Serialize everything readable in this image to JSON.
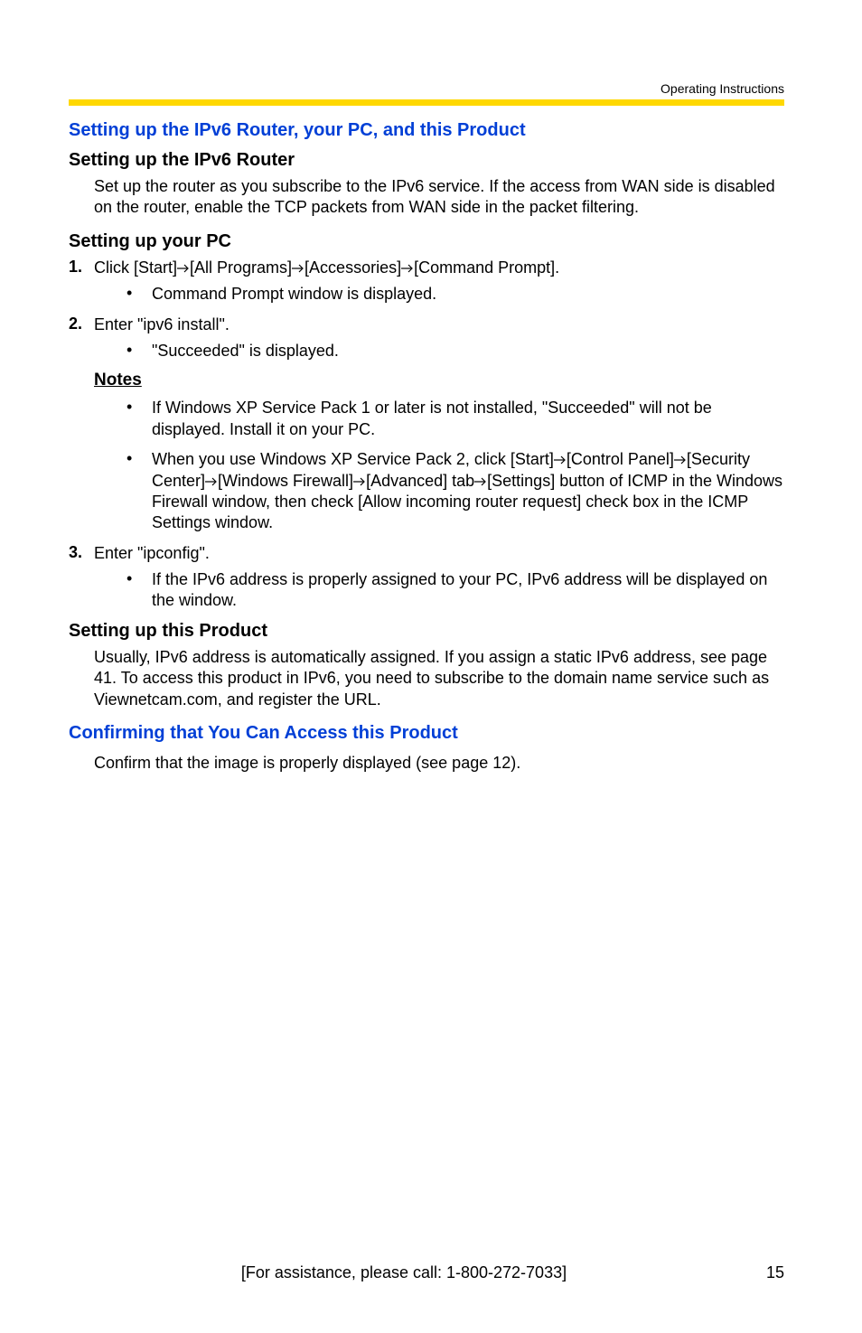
{
  "header": {
    "label": "Operating Instructions"
  },
  "s1": {
    "title": "Setting up the IPv6 Router, your PC, and this Product",
    "sub1": {
      "title": "Setting up the IPv6 Router",
      "body": "Set up the router as you subscribe to the IPv6 service. If the access from WAN side is disabled on the router, enable the TCP packets from WAN side in the packet filtering."
    },
    "sub2": {
      "title": "Setting up your PC",
      "step1": {
        "pre": "Click [Start]",
        "mid1": "[All Programs]",
        "mid2": "[Accessories]",
        "post": "[Command Prompt].",
        "bullet": "Command Prompt window is displayed."
      },
      "step2": {
        "text": "Enter \"ipv6 install\".",
        "bullet": "\"Succeeded\" is displayed."
      },
      "notes": {
        "label": "Notes",
        "n1": "If Windows XP Service Pack 1 or later is not installed, \"Succeeded\" will not be displayed. Install it on your PC.",
        "n2": {
          "a": "When you use Windows XP Service Pack 2, click [Start]",
          "b": "[Control Panel]",
          "c": "[Security Center]",
          "d": "[Windows Firewall]",
          "e": "[Advanced] tab",
          "f": "[Settings] button of ICMP in the Windows Firewall window, then check [Allow incoming router request] check box in the ICMP Settings window."
        }
      },
      "step3": {
        "text": "Enter \"ipconfig\".",
        "bullet": "If the IPv6 address is properly assigned to your PC, IPv6 address will be displayed on the window."
      }
    },
    "sub3": {
      "title": "Setting up this Product",
      "body": "Usually, IPv6 address is automatically assigned. If you assign a static IPv6 address, see page 41. To access this product in IPv6, you need to subscribe to the domain name service such as Viewnetcam.com, and register the URL."
    }
  },
  "s2": {
    "title": "Confirming that You Can Access this Product",
    "body": "Confirm that the image is properly displayed (see page 12)."
  },
  "footer": {
    "assist": "[For assistance, please call: 1-800-272-7033]",
    "page": "15"
  },
  "nums": {
    "one": "1.",
    "two": "2.",
    "three": "3."
  },
  "dot": "•"
}
